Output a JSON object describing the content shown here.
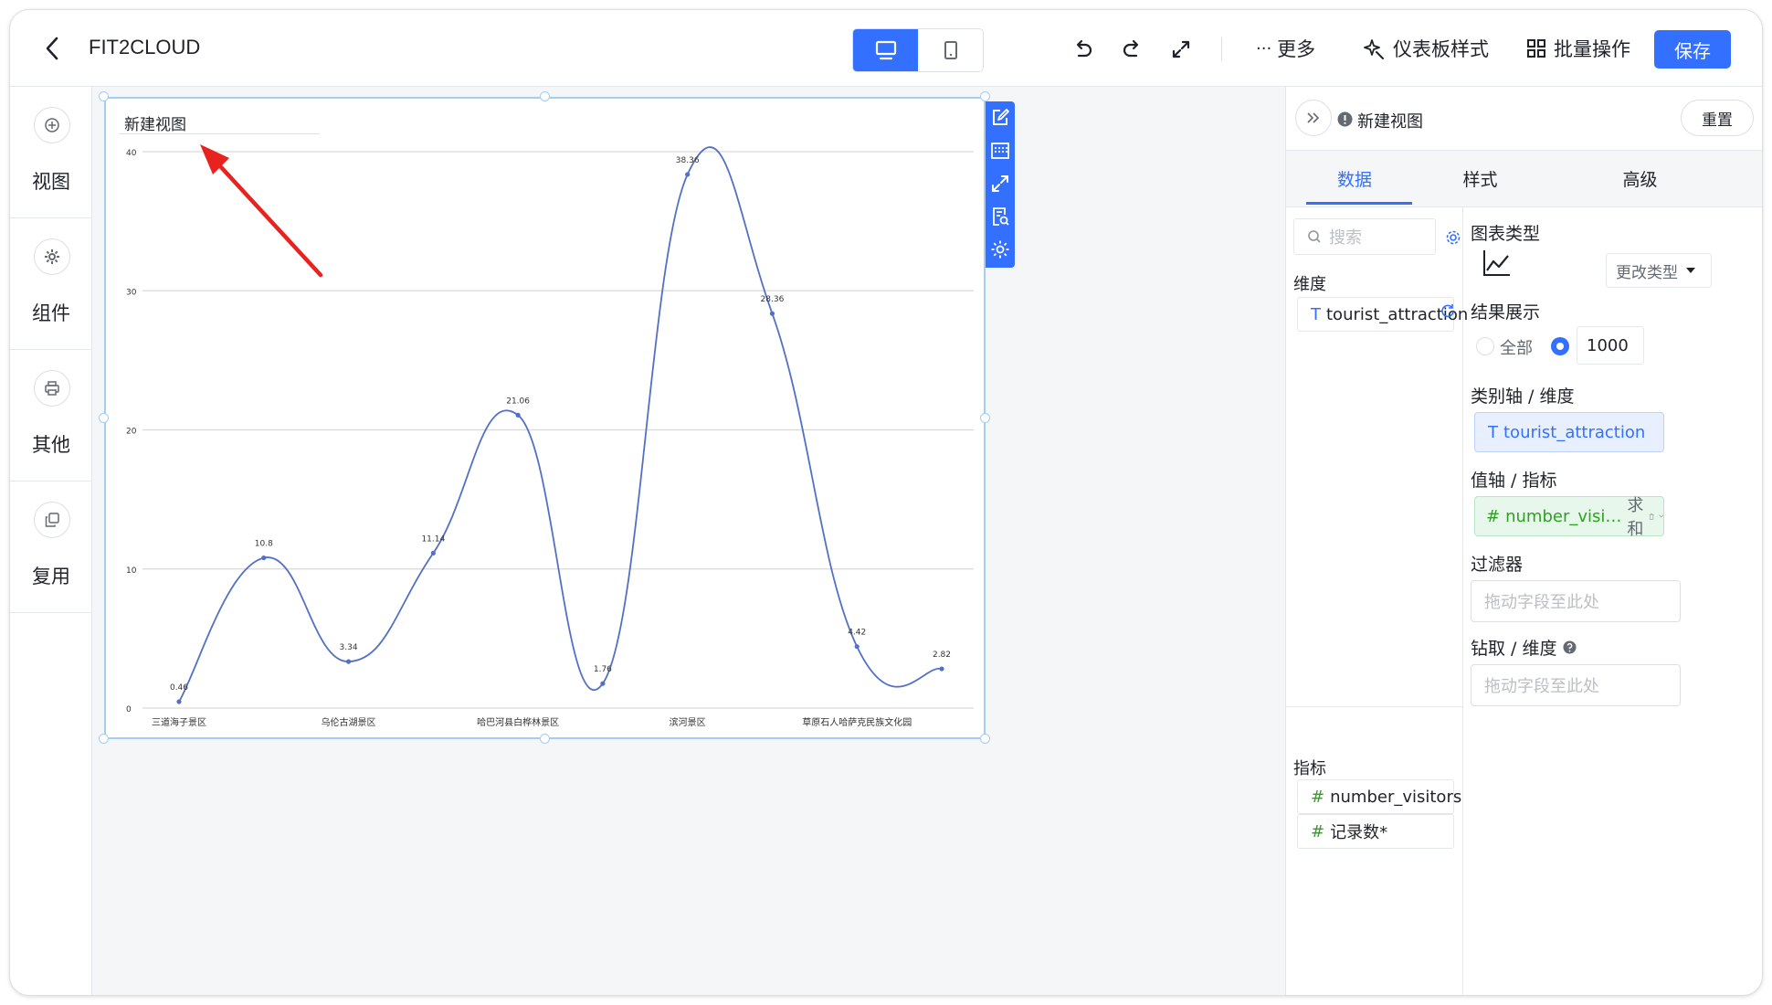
{
  "header": {
    "title": "FIT2CLOUD",
    "more_label": "更多",
    "dashboard_style_label": "仪表板样式",
    "batch_label": "批量操作",
    "save_label": "保存"
  },
  "leftbar": {
    "items": [
      {
        "label": "视图",
        "icon": "plus-circle-icon"
      },
      {
        "label": "组件",
        "icon": "gear-icon"
      },
      {
        "label": "其他",
        "icon": "printer-icon"
      },
      {
        "label": "复用",
        "icon": "copy-icon"
      }
    ]
  },
  "chart": {
    "title": "新建视图"
  },
  "chart_data": {
    "type": "line",
    "smooth": true,
    "categories": [
      "三道海子景区",
      "",
      "乌伦古湖景区",
      "",
      "哈巴河县白桦林景区",
      "",
      "滨河景区",
      "",
      "草原石人哈萨克民族文化园",
      ""
    ],
    "values": [
      0.46,
      10.8,
      3.34,
      11.14,
      21.06,
      1.76,
      38.36,
      28.36,
      4.42,
      2.82
    ],
    "labels": [
      "0.46",
      "10.8",
      "3.34",
      "11.14",
      "21.06",
      "1.76",
      "38.36",
      "28.36",
      "4.42",
      "2.82"
    ],
    "yticks": [
      "0",
      "10",
      "20",
      "30",
      "40"
    ],
    "ylim": [
      0,
      40
    ],
    "grid": true,
    "color": "#5470c6"
  },
  "panel": {
    "view_name": "新建视图",
    "reset_label": "重置",
    "tabs": [
      "数据",
      "样式",
      "高级"
    ],
    "search_placeholder": "搜索",
    "dimension_title": "维度",
    "dimension_fields": [
      "tourist_attraction"
    ],
    "metric_title": "指标",
    "metric_fields": [
      "number_visitors",
      "记录数*"
    ],
    "chart_type_title": "图表类型",
    "change_type_label": "更改类型",
    "result_title": "结果展示",
    "result_all_label": "全部",
    "result_count": "1000",
    "category_axis_title": "类别轴 / 维度",
    "category_axis_field": "tourist_attraction",
    "value_axis_title": "值轴 / 指标",
    "value_axis_field": "number_visi…",
    "value_axis_agg": "求和",
    "filter_title": "过滤器",
    "filter_placeholder": "拖动字段至此处",
    "drill_title": "钻取 / 维度",
    "drill_placeholder": "拖动字段至此处"
  }
}
